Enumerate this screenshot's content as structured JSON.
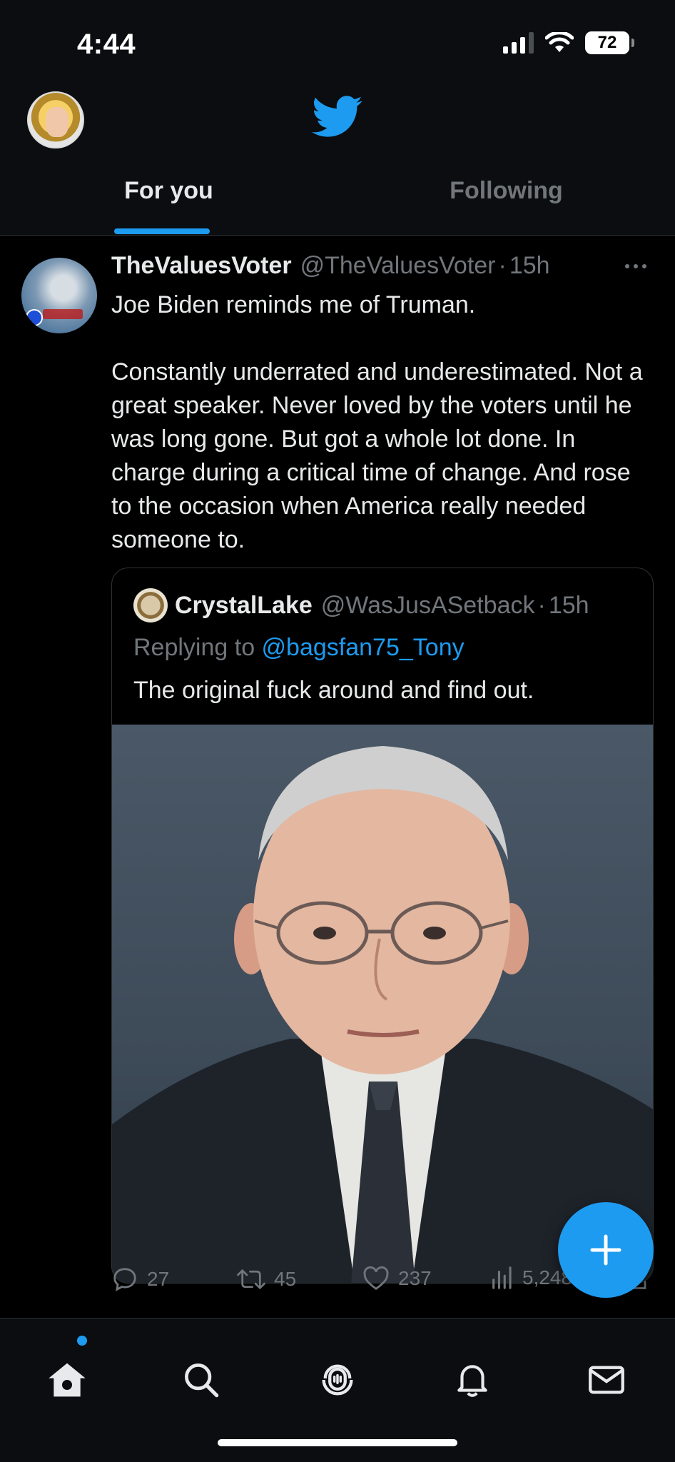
{
  "status_bar": {
    "time": "4:44",
    "battery": "72",
    "icons": [
      "cellular-signal-icon",
      "wifi-icon",
      "battery-icon"
    ]
  },
  "header": {
    "logo": "twitter-bird-icon",
    "tabs": [
      {
        "label": "For you",
        "active": true
      },
      {
        "label": "Following",
        "active": false
      }
    ]
  },
  "tweet": {
    "name": "TheValuesVoter",
    "handle": "@TheValuesVoter",
    "separator": "·",
    "time": "15h",
    "text": "Joe Biden reminds me of Truman.\n\nConstantly underrated and underestimated. Not a great speaker. Never loved by the voters until he was long gone. But got a whole lot done. In charge during a critical time of change. And rose to the occasion when America really needed someone to.",
    "quote": {
      "name": "CrystalLake",
      "handle": "@WasJusASetback",
      "separator": "·",
      "time": "15h",
      "replying_prefix": "Replying to ",
      "replying_to": "@bagsfan75_Tony",
      "text": "The original fuck around and find out."
    },
    "actions": {
      "replies": "27",
      "retweets": "45",
      "likes": "237",
      "views": "5,248"
    }
  },
  "fab_label": "+",
  "bottom_nav": [
    "home-icon",
    "search-icon",
    "spaces-icon",
    "notifications-icon",
    "messages-icon"
  ],
  "colors": {
    "accent": "#1d9bf0",
    "background": "#000000",
    "secondary_text": "#71767b"
  }
}
